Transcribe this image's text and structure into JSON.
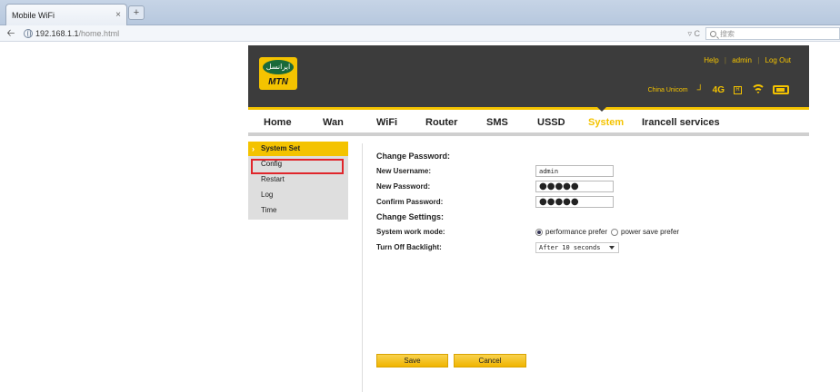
{
  "browser": {
    "tab_title": "Mobile WiFi",
    "tab_close": "×",
    "new_tab": "+",
    "url_host": "192.168.1.1",
    "url_path": "/home.html",
    "reload": "▿ C",
    "search_placeholder": "搜索"
  },
  "header": {
    "logo_script": "ایرانسل",
    "logo_brand": "MTN",
    "link_help": "Help",
    "link_user": "admin",
    "link_logout": "Log Out",
    "separator": "|",
    "carrier": "China Unicom",
    "network": "4G",
    "roaming": "R"
  },
  "menu": {
    "items": [
      "Home",
      "Wan",
      "WiFi",
      "Router",
      "SMS",
      "USSD",
      "System",
      "Irancell services"
    ],
    "active": "System"
  },
  "sidebar": {
    "title": "System Set",
    "items": [
      "Config",
      "Restart",
      "Log",
      "Time"
    ]
  },
  "form": {
    "section_password": "Change Password:",
    "username_label": "New Username:",
    "username_value": "admin",
    "password_label": "New Password:",
    "password_value": "●●●●●",
    "confirm_label": "Confirm Password:",
    "confirm_value": "●●●●●",
    "section_settings": "Change Settings:",
    "mode_label": "System work mode:",
    "mode_option_1": "performance prefer",
    "mode_option_2": "power save prefer",
    "backlight_label": "Turn Off Backlight:",
    "backlight_value": "After 10 seconds"
  },
  "buttons": {
    "save": "Save",
    "cancel": "Cancel"
  },
  "colors": {
    "accent": "#f4c300",
    "header_bg": "#3c3c3c",
    "highlight_border": "#e0262b"
  }
}
